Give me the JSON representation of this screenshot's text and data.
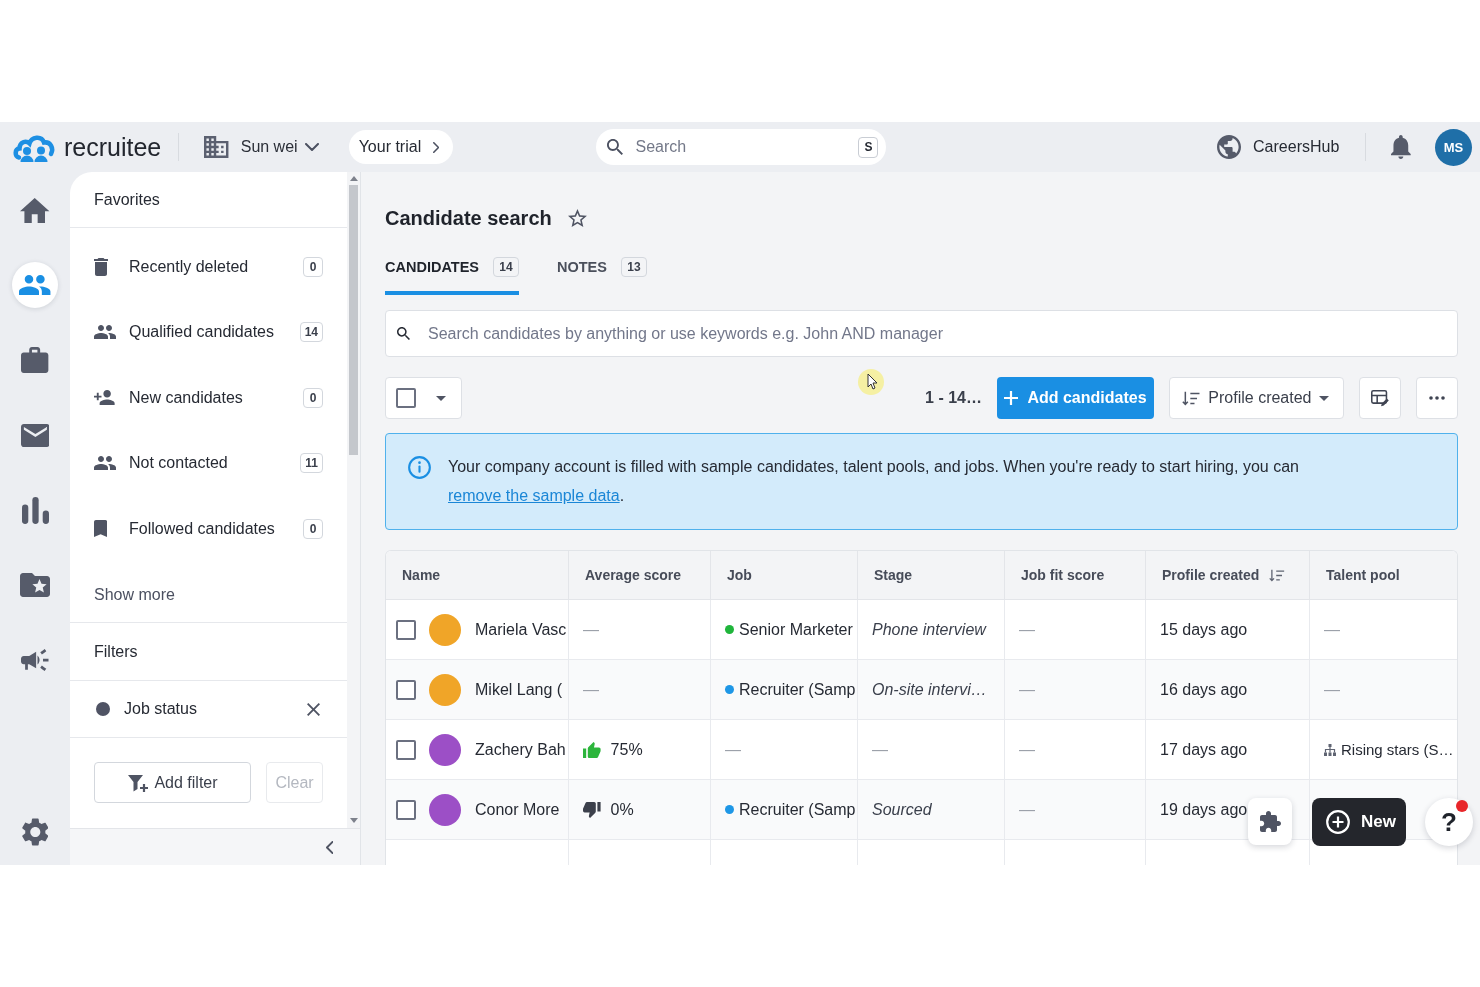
{
  "topbar": {
    "brand": "recruitee",
    "workspace": "Sun wei",
    "trial": "Your trial",
    "search": {
      "placeholder": "Search",
      "shortcut": "S"
    },
    "careers_site": "CareersHub",
    "user_initials": "MS"
  },
  "nav_rail": [
    {
      "selected": false
    },
    {
      "selected": true
    },
    {
      "selected": false
    },
    {
      "selected": false
    },
    {
      "selected": false
    },
    {
      "selected": false
    },
    {
      "selected": false
    },
    {
      "selected": false
    }
  ],
  "sidebar": {
    "favorites_title": "Favorites",
    "favorites": [
      {
        "label": "Recently deleted",
        "count": "0",
        "selected": false
      },
      {
        "label": "Qualified candidates",
        "count": "14",
        "selected": false
      },
      {
        "label": "New candidates",
        "count": "0",
        "selected": false
      },
      {
        "label": "Not contacted",
        "count": "11",
        "selected": false
      },
      {
        "label": "Followed candidates",
        "count": "0",
        "selected": false
      }
    ],
    "show_more": "Show more",
    "filters_title": "Filters",
    "filters": [
      {
        "label": "Job status"
      }
    ],
    "add_filter": "Add filter",
    "clear": {
      "label": "Clear",
      "disabled": true
    }
  },
  "page": {
    "title": "Candidate search",
    "tabs": [
      {
        "label": "CANDIDATES",
        "count": "14",
        "selected": true
      },
      {
        "label": "NOTES",
        "count": "13",
        "selected": false
      }
    ],
    "search": {
      "placeholder": "Search candidates by anything or use keywords e.g. John AND manager"
    },
    "toolbar": {
      "select_all": {
        "checked": false
      },
      "range": "1 - 14…",
      "add_button": "Add candidates",
      "sort": "Profile created"
    },
    "banner": {
      "text": "Your company account is filled with sample candidates, talent pools, and jobs. When you're ready to start hiring, you can ",
      "link": "remove the sample data",
      "after": "."
    }
  },
  "table": {
    "columns": [
      {
        "label": "Name",
        "sorted": false
      },
      {
        "label": "Average score",
        "sorted": false
      },
      {
        "label": "Job",
        "sorted": false
      },
      {
        "label": "Stage",
        "sorted": false
      },
      {
        "label": "Job fit score",
        "sorted": false
      },
      {
        "label": "Profile created",
        "sorted": true
      },
      {
        "label": "Talent pool",
        "sorted": false
      }
    ],
    "rows": [
      {
        "checked": false,
        "avatar": {
          "color": "#f0a528"
        },
        "name": "Mariela Vasc",
        "average_score": {
          "kind": "empty",
          "text": "—"
        },
        "job": {
          "kind": "job",
          "text": "Senior Marketer",
          "color": "#1fb53b"
        },
        "stage": {
          "kind": "stage",
          "text": "Phone interview"
        },
        "job_fit_score": "—",
        "profile_created": "15 days ago",
        "talent_pool": {
          "kind": "empty",
          "text": "—"
        }
      },
      {
        "checked": false,
        "avatar": {
          "color": "#f0a528"
        },
        "name": "Mikel Lang (",
        "average_score": {
          "kind": "empty",
          "text": "—"
        },
        "job": {
          "kind": "job",
          "text": "Recruiter (Samp",
          "color": "#1e97e6"
        },
        "stage": {
          "kind": "stage",
          "text": "On-site intervi…"
        },
        "job_fit_score": "—",
        "profile_created": "16 days ago",
        "talent_pool": {
          "kind": "empty",
          "text": "—"
        }
      },
      {
        "checked": false,
        "avatar": {
          "color": "#9c4fc6"
        },
        "name": "Zachery Bah",
        "average_score": {
          "kind": "positive",
          "text": "75%"
        },
        "job": {
          "kind": "empty",
          "text": "—"
        },
        "stage": {
          "kind": "empty",
          "text": "—"
        },
        "job_fit_score": "—",
        "profile_created": "17 days ago",
        "talent_pool": {
          "kind": "pool",
          "text": "Rising stars (S…"
        }
      },
      {
        "checked": false,
        "avatar": {
          "color": "#9c4fc6"
        },
        "name": "Conor More",
        "average_score": {
          "kind": "negative",
          "text": "0%"
        },
        "job": {
          "kind": "job",
          "text": "Recruiter (Samp",
          "color": "#1e97e6"
        },
        "stage": {
          "kind": "stage",
          "text": "Sourced"
        },
        "job_fit_score": "—",
        "profile_created": "19 days ago"
      }
    ]
  },
  "floating": {
    "new_button": "New",
    "help": {
      "label": "?",
      "unread": true
    }
  }
}
